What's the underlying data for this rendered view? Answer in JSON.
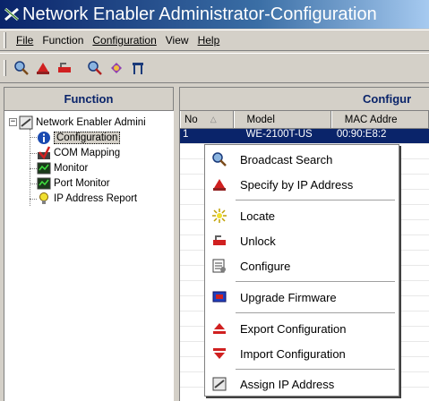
{
  "window": {
    "title": "Network Enabler Administrator-Configuration"
  },
  "menubar": {
    "items": [
      "File",
      "Function",
      "Configuration",
      "View",
      "Help"
    ]
  },
  "toolbar": {
    "icons": [
      "broadcast-search-icon",
      "specify-ip-icon",
      "unlock-icon",
      "locate-icon",
      "configure-icon",
      "tools-icon"
    ]
  },
  "left": {
    "header": "Function",
    "tree": {
      "root": "Network Enabler Admini",
      "children": [
        "Configuration",
        "COM Mapping",
        "Monitor",
        "Port Monitor",
        "IP Address Report"
      ]
    }
  },
  "right": {
    "header": "Configur",
    "columns": [
      "No",
      "Model",
      "MAC Addre"
    ],
    "rows": [
      {
        "no": "1",
        "model": "WE-2100T-US",
        "mac": "00:90:E8:2"
      }
    ]
  },
  "context_menu": {
    "items": [
      "Broadcast Search",
      "Specify by IP Address",
      "Locate",
      "Unlock",
      "Configure",
      "Upgrade Firmware",
      "Export Configuration",
      "Import Configuration",
      "Assign IP Address"
    ]
  },
  "colors": {
    "title_start": "#0a246a",
    "title_end": "#a6caf0",
    "face": "#d4d0c8",
    "header_text": "#0a246a",
    "selection": "#0a246a"
  }
}
